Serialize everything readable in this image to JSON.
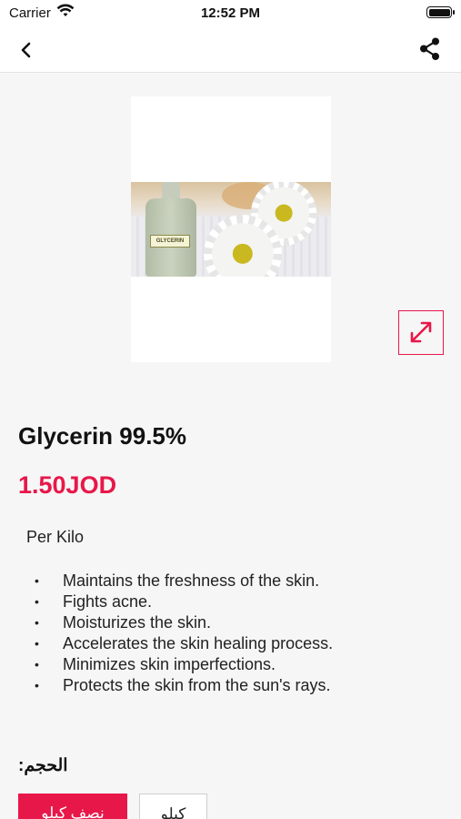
{
  "status_bar": {
    "carrier": "Carrier",
    "time": "12:52 PM"
  },
  "product": {
    "image_label": "GLYCERIN",
    "name": "Glycerin 99.5%",
    "price": "1.50JOD",
    "unit": "Per Kilo",
    "benefits": [
      "Maintains the freshness of the skin.",
      "Fights acne.",
      "Moisturizes the skin.",
      "Accelerates the skin healing process.",
      "Minimizes skin imperfections.",
      "Protects the skin from the sun's rays."
    ]
  },
  "size_selector": {
    "label": "الحجم:",
    "options": [
      "نصف كيلو",
      "كيلو"
    ],
    "selected_index": 0
  },
  "colors": {
    "accent": "#e8174a",
    "background": "#f6f6f6"
  }
}
